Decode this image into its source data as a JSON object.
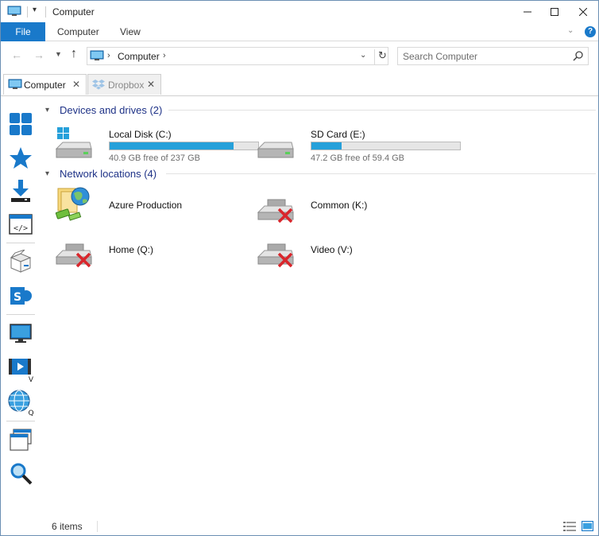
{
  "window": {
    "title": "Computer"
  },
  "ribbon": {
    "tabs": [
      {
        "label": "File"
      },
      {
        "label": "Computer"
      },
      {
        "label": "View"
      }
    ]
  },
  "address": {
    "location": "Computer",
    "chevron": "›"
  },
  "search": {
    "placeholder": "Search Computer"
  },
  "folder_tabs": [
    {
      "label": "Computer",
      "active": true
    },
    {
      "label": "Dropbox",
      "active": false
    }
  ],
  "left_toolbar": [
    {
      "icon": "tiles-icon"
    },
    {
      "icon": "favorites-star-icon"
    },
    {
      "icon": "download-icon"
    },
    {
      "icon": "code-window-icon"
    },
    {
      "icon": "package-box-icon"
    },
    {
      "icon": "sharepoint-icon"
    },
    {
      "icon": "monitor-icon"
    },
    {
      "icon": "video-folder-icon",
      "badge": "V"
    },
    {
      "icon": "globe-icon",
      "badge": "Q"
    },
    {
      "icon": "windows-stack-icon"
    },
    {
      "icon": "magnifier-icon"
    }
  ],
  "groups": {
    "devices": {
      "label": "Devices and drives (2)",
      "items": [
        {
          "name": "Local Disk (C:)",
          "free": "40.9 GB free of 237 GB",
          "used_fraction": 0.827
        },
        {
          "name": "SD Card (E:)",
          "free": "47.2 GB free of 59.4 GB",
          "used_fraction": 0.205
        }
      ]
    },
    "network": {
      "label": "Network locations (4)",
      "items": [
        {
          "name": "Azure Production"
        },
        {
          "name": "Common (K:)"
        },
        {
          "name": "Home (Q:)"
        },
        {
          "name": "Video (V:)"
        }
      ]
    }
  },
  "status": {
    "item_count": "6 items"
  },
  "colors": {
    "accent": "#1979ca",
    "drive_bar": "#26a0da",
    "group_header": "#1e3287",
    "disconnected_x": "#d9262c"
  }
}
